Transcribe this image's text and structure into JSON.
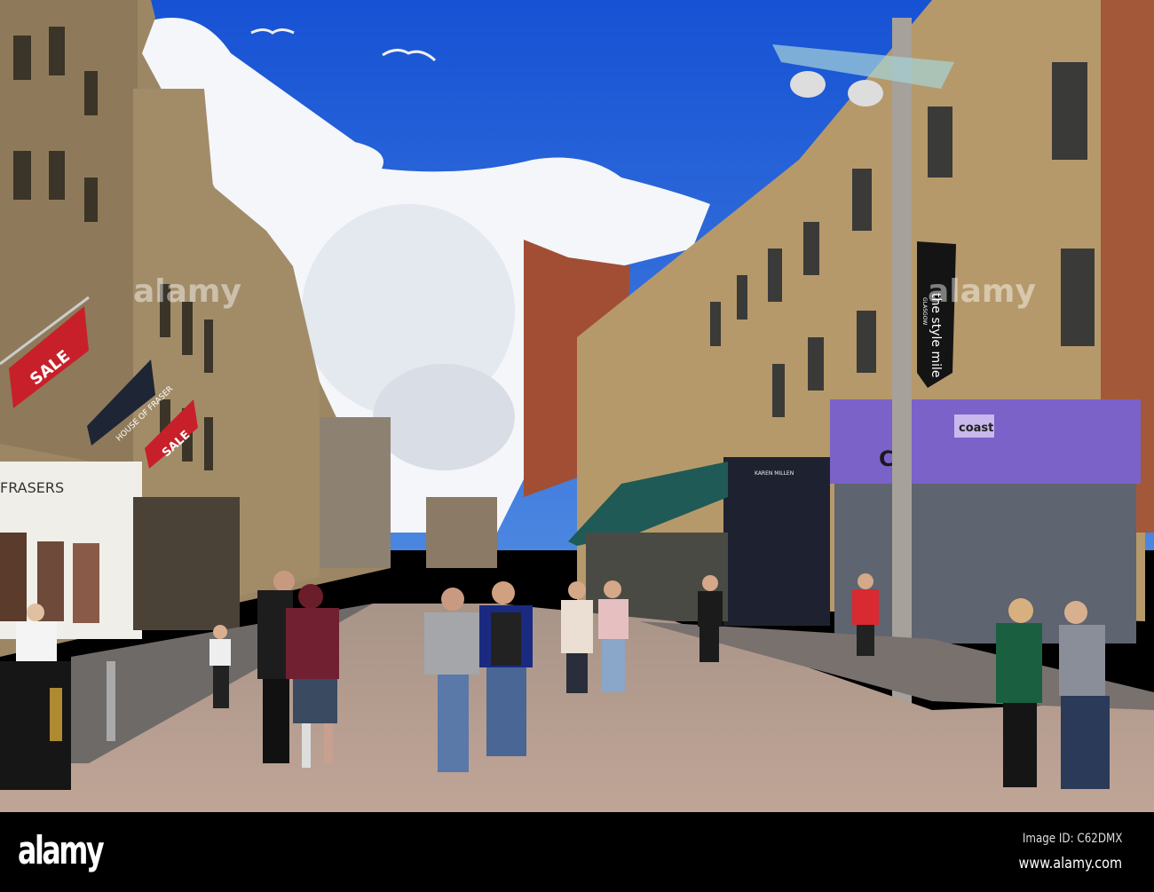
{
  "photo": {
    "signs": {
      "sale_1": "SALE",
      "sale_2": "SALE",
      "house_of_fraser": "HOUSE OF FRASER",
      "frasers": "FRASERS",
      "style_mile": "the style mile",
      "glasgow": "GLASGOW",
      "coast_small": "coast",
      "coast_large": "CO",
      "karen_millen": "KAREN MILLEN"
    },
    "colors": {
      "sky": "#1f63d6",
      "sandstone": "#b89a6a",
      "coast_purple": "#7a62c9",
      "pavement": "#b39a8a"
    }
  },
  "watermark": {
    "logo": "alamy",
    "image_id": "Image ID: C62DMX",
    "url": "www.alamy.com"
  }
}
